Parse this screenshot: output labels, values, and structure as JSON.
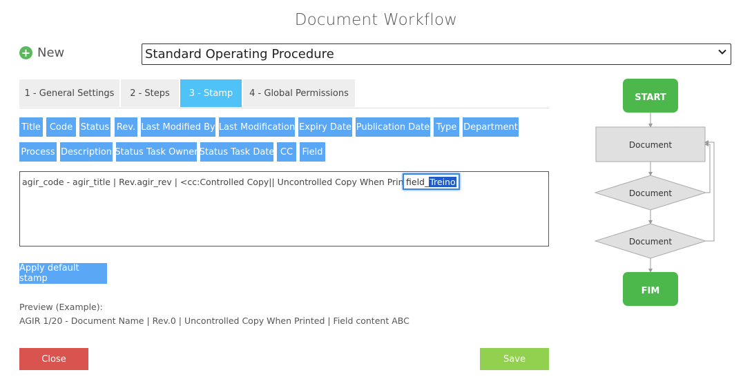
{
  "header": {
    "title": "Document Workflow"
  },
  "new_button": {
    "label": "New",
    "icon": "plus-circle-icon",
    "color": "#5cb85c"
  },
  "workflow_select": {
    "value": "Standard Operating Procedure"
  },
  "tabs": [
    {
      "label": "1 - General Settings",
      "active": false
    },
    {
      "label": "2 - Steps",
      "active": false
    },
    {
      "label": "3 - Stamp",
      "active": true
    },
    {
      "label": "4 - Global Permissions",
      "active": false
    }
  ],
  "fields_row1": [
    "Title",
    "Code",
    "Status",
    "Rev.",
    "Last Modified By",
    "Last Modification",
    "Expiry Date",
    "Publication Date",
    "Type",
    "Department"
  ],
  "fields_row2": [
    "Process",
    "Description",
    "Status Task Owner",
    "Status Task Date",
    "CC",
    "Field"
  ],
  "editor": {
    "text": "agir_code - agir_title | Rev.agir_rev | <cc:Controlled Copy|| Uncontrolled Copy When Printed >",
    "field_tag_prefix": "field_",
    "field_tag_selected": "Treino"
  },
  "apply_default_label": "Apply default stamp",
  "preview": {
    "label": "Preview (Example):",
    "text": "AGIR 1/20 - Document Name | Rev.0 | Uncontrolled Copy When Printed | Field content ABC"
  },
  "actions": {
    "close_label": "Close",
    "save_label": "Save"
  },
  "flowchart": {
    "start": "START",
    "step1": "Document",
    "step2": "Document",
    "step3": "Document",
    "end": "FIM"
  },
  "colors": {
    "accent": "#5aa7f5",
    "active_tab": "#4fc3f7",
    "close": "#d9534f",
    "save": "#92d050",
    "flow_terminal": "#4cb84c"
  }
}
